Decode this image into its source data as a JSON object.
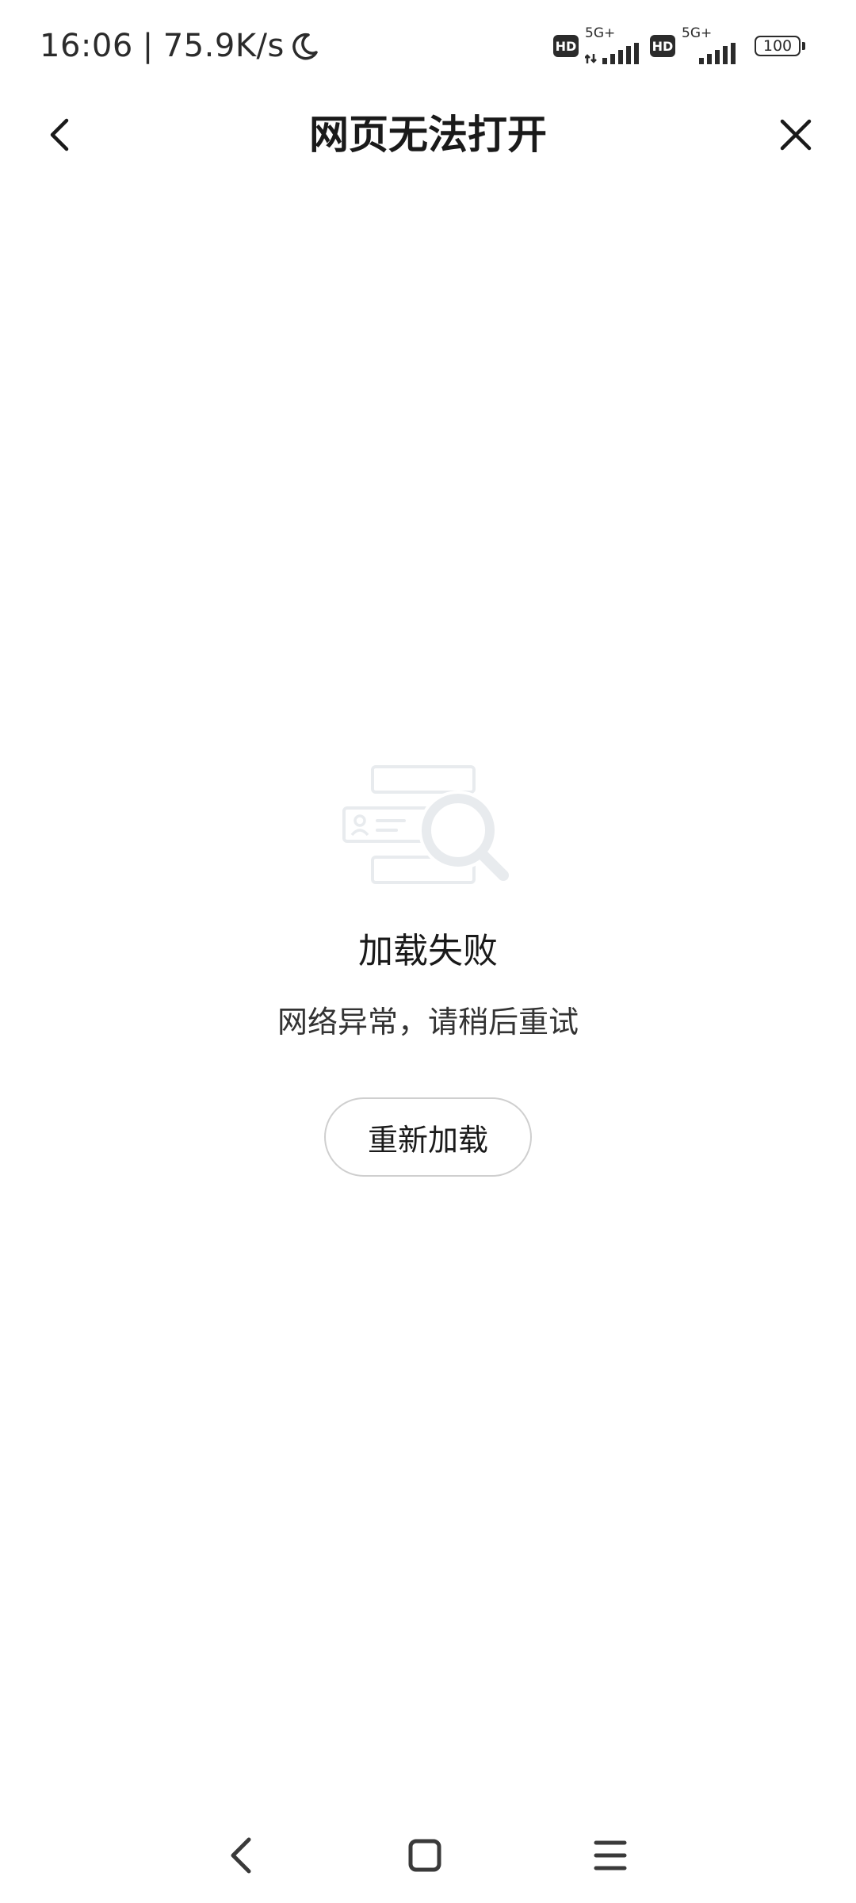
{
  "status_bar": {
    "time": "16:06",
    "separator": "|",
    "network_speed": "75.9K/s",
    "sim1": {
      "hd": "HD",
      "network": "5G+"
    },
    "sim2": {
      "hd": "HD",
      "network": "5G+"
    },
    "battery": "100",
    "icons": [
      "moon-icon",
      "signal-icon",
      "battery-icon"
    ]
  },
  "header": {
    "title": "网页无法打开",
    "back_icon": "chevron-left-icon",
    "close_icon": "close-icon"
  },
  "error": {
    "illustration_icon": "search-empty-illustration",
    "title": "加载失败",
    "subtitle": "网络异常，请稍后重试",
    "reload_label": "重新加载"
  },
  "nav_bar": {
    "icons": [
      "back-icon",
      "home-icon",
      "menu-icon"
    ]
  },
  "colors": {
    "text_primary": "#1a1a1a",
    "text_secondary": "#333333",
    "button_border": "#cfcfcf",
    "illustration": "#e8ebee",
    "background": "#ffffff"
  }
}
